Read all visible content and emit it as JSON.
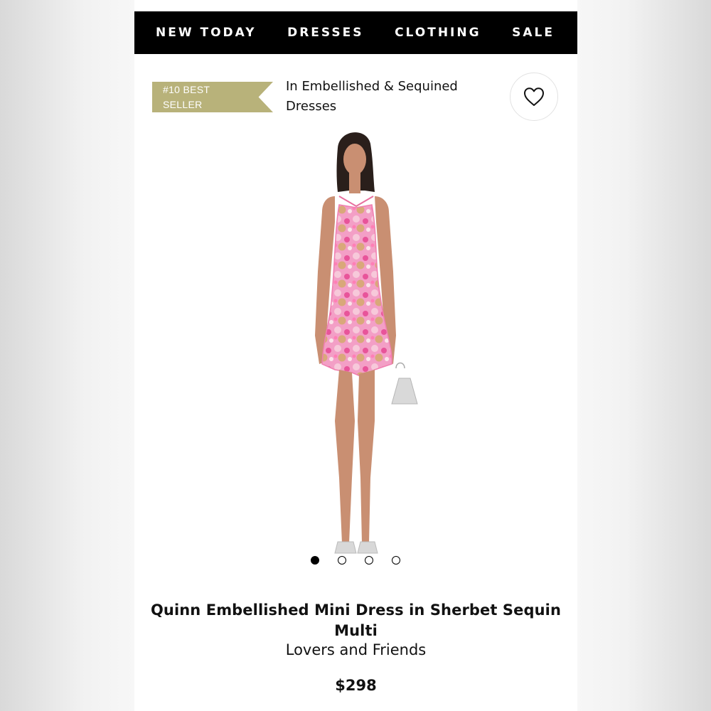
{
  "nav": {
    "items": [
      {
        "label": "NEW TODAY"
      },
      {
        "label": "DRESSES"
      },
      {
        "label": "CLOTHING"
      },
      {
        "label": "SALE"
      }
    ]
  },
  "badge": {
    "line1": "#10 BEST",
    "line2": "SELLER",
    "color": "#b8b27a"
  },
  "category": {
    "text": "In Embellished & Sequined Dresses"
  },
  "wishlist": {
    "icon": "heart-icon"
  },
  "product": {
    "title": "Quinn Embellished Mini Dress in Sherbet Sequin Multi",
    "brand": "Lovers and Friends",
    "price": "$298",
    "image_count": 4,
    "active_image": 1
  },
  "colors": {
    "nav_background": "#000000",
    "accent_gold": "#b8b27a",
    "dress_pink": "#f2a0c4"
  }
}
